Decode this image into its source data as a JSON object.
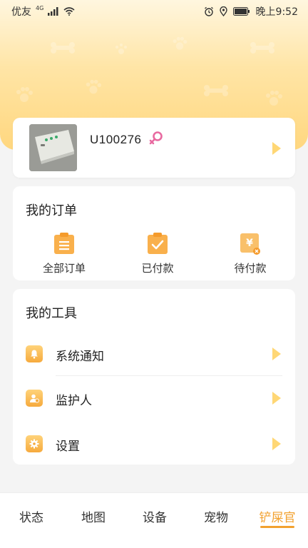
{
  "status_bar": {
    "carrier": "优友",
    "network": "4G",
    "time": "晚上9:52"
  },
  "profile": {
    "user_id": "U100276",
    "gender_icon": "female-icon"
  },
  "orders": {
    "title": "我的订单",
    "items": [
      {
        "label": "全部订单",
        "icon": "clipboard-list-icon"
      },
      {
        "label": "已付款",
        "icon": "clipboard-check-icon"
      },
      {
        "label": "待付款",
        "icon": "yen-pending-icon"
      }
    ]
  },
  "tools": {
    "title": "我的工具",
    "items": [
      {
        "label": "系统通知",
        "icon": "bell-icon"
      },
      {
        "label": "监护人",
        "icon": "guardian-icon"
      },
      {
        "label": "设置",
        "icon": "gear-icon"
      }
    ]
  },
  "bottom_nav": {
    "items": [
      {
        "label": "状态"
      },
      {
        "label": "地图"
      },
      {
        "label": "设备"
      },
      {
        "label": "宠物"
      },
      {
        "label": "铲屎官",
        "active": true
      }
    ]
  },
  "colors": {
    "accent": "#f2a12f",
    "header_gradient_top": "#fff6df",
    "header_gradient_bottom": "#ffd77f",
    "chevron": "#ffd775",
    "female_icon": "#e86aa0"
  }
}
